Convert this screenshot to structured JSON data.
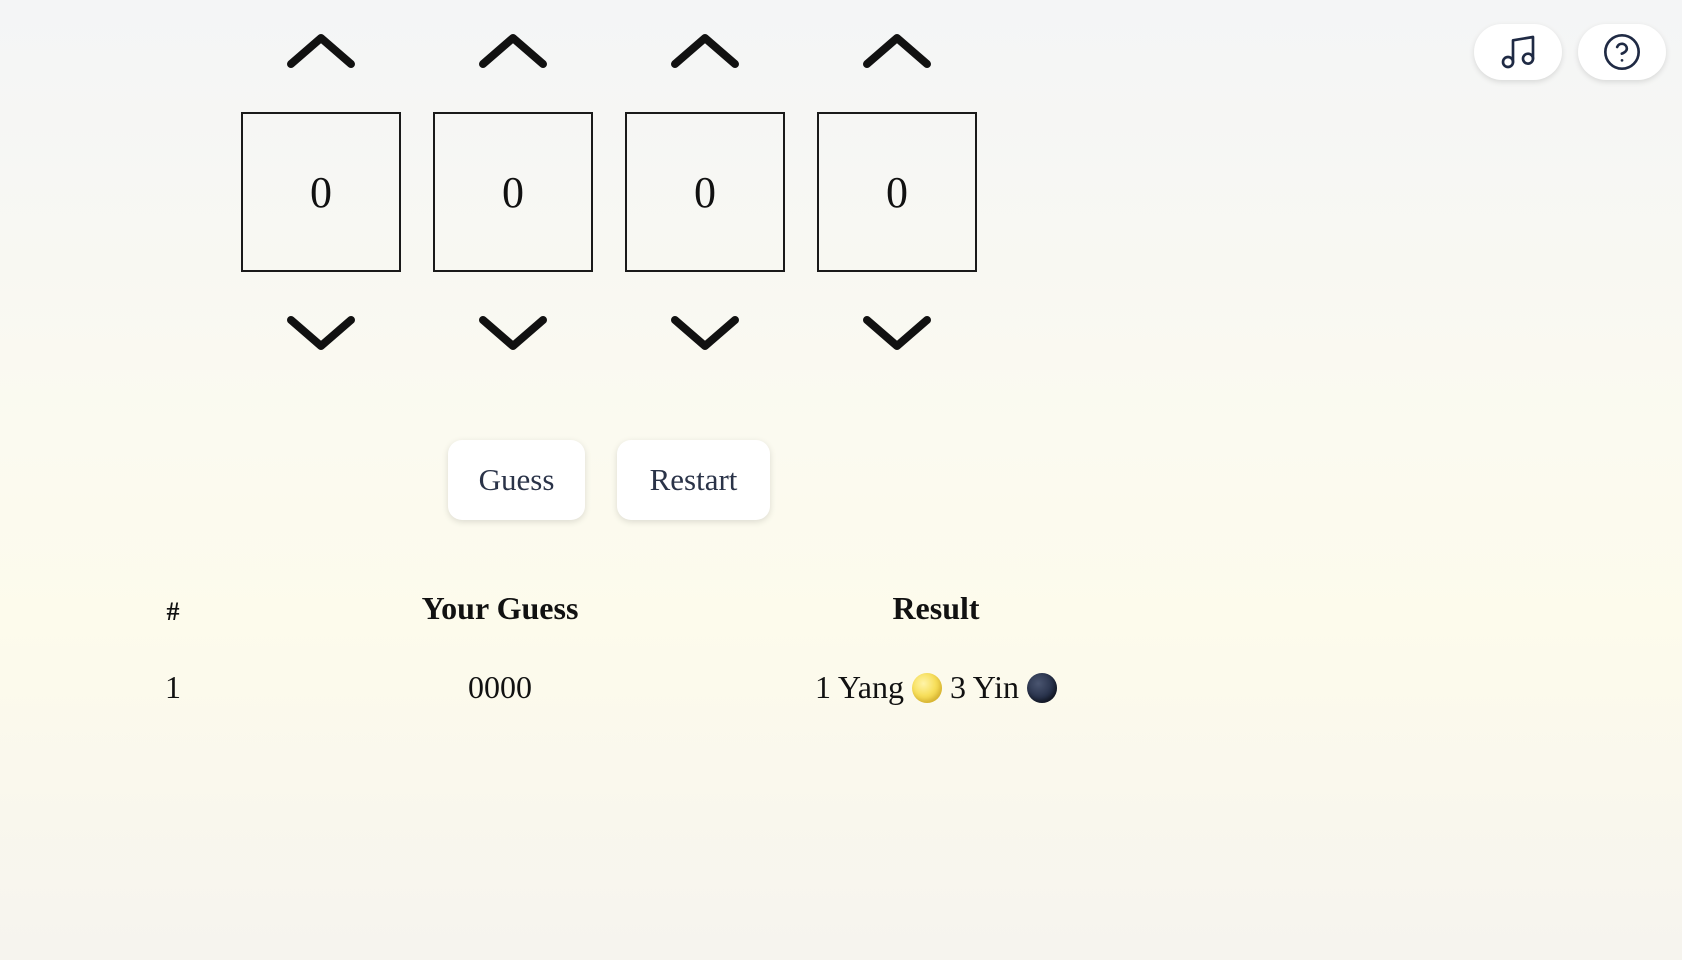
{
  "header": {
    "music_icon": "music-note-icon",
    "help_icon": "question-circle-icon"
  },
  "digits": [
    {
      "value": "0",
      "up_icon": "chevron-up-icon",
      "down_icon": "chevron-down-icon"
    },
    {
      "value": "0",
      "up_icon": "chevron-up-icon",
      "down_icon": "chevron-down-icon"
    },
    {
      "value": "0",
      "up_icon": "chevron-up-icon",
      "down_icon": "chevron-down-icon"
    },
    {
      "value": "0",
      "up_icon": "chevron-up-icon",
      "down_icon": "chevron-down-icon"
    }
  ],
  "actions": {
    "guess_label": "Guess",
    "restart_label": "Restart"
  },
  "table": {
    "headers": [
      "#",
      "Your Guess",
      "Result"
    ],
    "rows": [
      {
        "num": "1",
        "guess": "0000",
        "yang_text": "1 Yang",
        "yang_icon": "full-moon-icon",
        "yin_text": "3 Yin",
        "yin_icon": "new-moon-icon"
      }
    ]
  },
  "colors": {
    "button_text": "#2a3348",
    "box_border": "#1a1a1a",
    "icon_stroke": "#1f2a44"
  }
}
